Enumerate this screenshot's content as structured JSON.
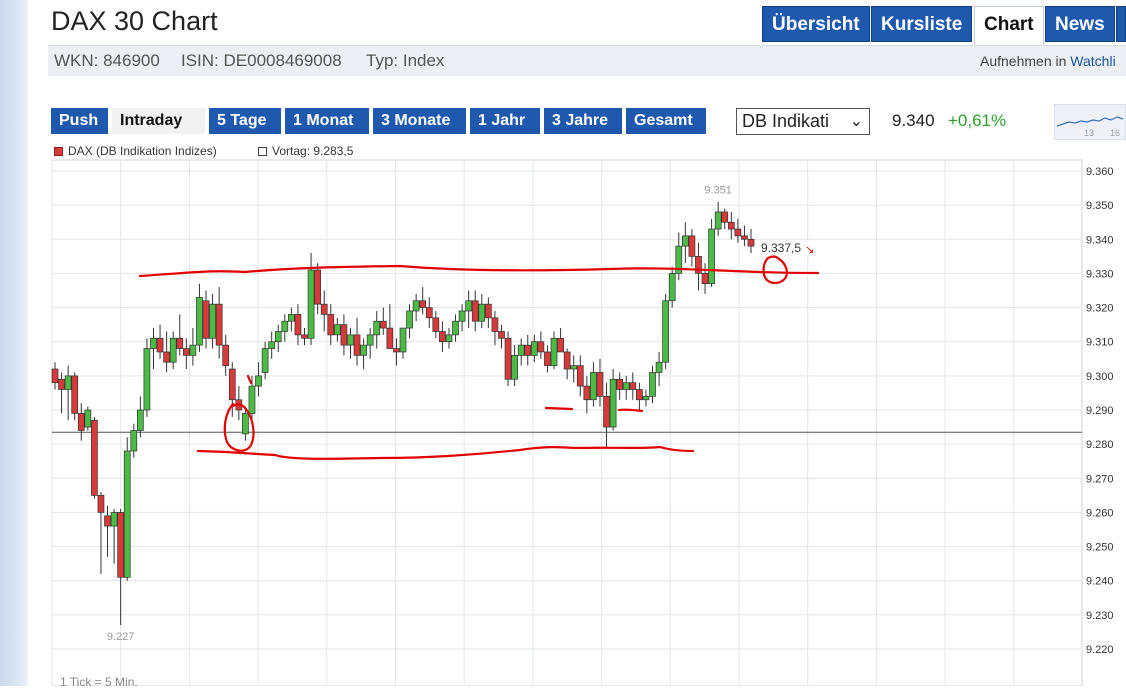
{
  "header": {
    "title": "DAX 30 Chart",
    "wkn": "WKN: 846900",
    "isin": "ISIN: DE0008469008",
    "typ": "Typ: Index",
    "watch_prefix": "Aufnehmen in",
    "watch_link": "Watchli",
    "tabs": [
      "Übersicht",
      "Kursliste",
      "Chart",
      "News"
    ],
    "active_tab": "Chart"
  },
  "toolbar": {
    "ranges": [
      "Push",
      "Intraday",
      "5 Tage",
      "1 Monat",
      "3 Monate",
      "1 Jahr",
      "3 Jahre",
      "Gesamt"
    ],
    "active_range": "Intraday",
    "source_select": "DB Indikati",
    "price": "9.340",
    "change": "+0,61%"
  },
  "mini_chart": {
    "labels": [
      "13",
      "16"
    ]
  },
  "legend": {
    "series_label": "DAX (DB Indikation Indizes)",
    "prev_close_label": "Vortag: 9.283,5"
  },
  "footer": {
    "tick_note": "1 Tick = 5 Min."
  },
  "colors": {
    "up": "#4cbb46",
    "down": "#d63a3a",
    "annotation": "#e00000",
    "tab_blue": "#1f59ad"
  },
  "chart_data": {
    "type": "candlestick",
    "y_ticks": [
      "9.360",
      "9.350",
      "9.340",
      "9.330",
      "9.320",
      "9.310",
      "9.300",
      "9.290",
      "9.280",
      "9.270",
      "9.260",
      "9.250",
      "9.240",
      "9.230",
      "9.220"
    ],
    "ylim": [
      9218,
      9362
    ],
    "reference_line": 9283.5,
    "high_label": "9.351",
    "high_value": 9351,
    "low_label": "9.227",
    "low_value": 9227,
    "last_label": "9.337,5",
    "last_value": 9337.5,
    "candles": [
      [
        9302,
        9304,
        9296,
        9298
      ],
      [
        9299,
        9301,
        9289,
        9296
      ],
      [
        9296,
        9303,
        9287,
        9300
      ],
      [
        9300,
        9301,
        9287,
        9289
      ],
      [
        9289,
        9292,
        9281,
        9284
      ],
      [
        9285,
        9291,
        9284,
        9290
      ],
      [
        9287,
        9288,
        9264,
        9265
      ],
      [
        9265,
        9266,
        9242,
        9260
      ],
      [
        9259,
        9262,
        9247,
        9256
      ],
      [
        9256,
        9261,
        9245,
        9260
      ],
      [
        9260,
        9261,
        9227,
        9241
      ],
      [
        9241,
        9282,
        9240,
        9278
      ],
      [
        9278,
        9286,
        9276,
        9284
      ],
      [
        9284,
        9294,
        9282,
        9290
      ],
      [
        9290,
        9311,
        9288,
        9308
      ],
      [
        9308,
        9314,
        9302,
        9311
      ],
      [
        9311,
        9315,
        9305,
        9307
      ],
      [
        9307,
        9313,
        9301,
        9304
      ],
      [
        9304,
        9313,
        9302,
        9311
      ],
      [
        9311,
        9318,
        9306,
        9308
      ],
      [
        9308,
        9311,
        9302,
        9306
      ],
      [
        9306,
        9314,
        9303,
        9309
      ],
      [
        9309,
        9327,
        9307,
        9323
      ],
      [
        9322,
        9325,
        9308,
        9311
      ],
      [
        9311,
        9324,
        9308,
        9321
      ],
      [
        9321,
        9326,
        9305,
        9309
      ],
      [
        9309,
        9312,
        9300,
        9303
      ],
      [
        9302,
        9304,
        9288,
        9293
      ],
      [
        9293,
        9297,
        9287,
        9290
      ],
      [
        9283,
        9291,
        9281,
        9289
      ],
      [
        9289,
        9300,
        9287,
        9297
      ],
      [
        9297,
        9304,
        9294,
        9300
      ],
      [
        9301,
        9310,
        9299,
        9308
      ],
      [
        9308,
        9313,
        9305,
        9310
      ],
      [
        9310,
        9315,
        9307,
        9313
      ],
      [
        9313,
        9318,
        9310,
        9316
      ],
      [
        9316,
        9320,
        9313,
        9318
      ],
      [
        9318,
        9321,
        9309,
        9312
      ],
      [
        9312,
        9314,
        9309,
        9311
      ],
      [
        9311,
        9336,
        9309,
        9331
      ],
      [
        9331,
        9333,
        9318,
        9321
      ],
      [
        9321,
        9325,
        9313,
        9318
      ],
      [
        9318,
        9321,
        9309,
        9312
      ],
      [
        9312,
        9317,
        9310,
        9315
      ],
      [
        9315,
        9318,
        9306,
        9309
      ],
      [
        9309,
        9314,
        9305,
        9312
      ],
      [
        9312,
        9317,
        9303,
        9306
      ],
      [
        9306,
        9311,
        9302,
        9309
      ],
      [
        9309,
        9314,
        9305,
        9312
      ],
      [
        9312,
        9319,
        9308,
        9316
      ],
      [
        9316,
        9320,
        9312,
        9314
      ],
      [
        9314,
        9321,
        9310,
        9308
      ],
      [
        9308,
        9311,
        9303,
        9307
      ],
      [
        9307,
        9310,
        9305,
        9314
      ],
      [
        9314,
        9321,
        9311,
        9319
      ],
      [
        9319,
        9324,
        9316,
        9322
      ],
      [
        9322,
        9326,
        9318,
        9320
      ],
      [
        9320,
        9323,
        9314,
        9317
      ],
      [
        9317,
        9319,
        9311,
        9313
      ],
      [
        9313,
        9316,
        9307,
        9310
      ],
      [
        9310,
        9314,
        9308,
        9312
      ],
      [
        9312,
        9318,
        9310,
        9316
      ],
      [
        9316,
        9321,
        9313,
        9319
      ],
      [
        9319,
        9325,
        9314,
        9322
      ],
      [
        9322,
        9325,
        9313,
        9316
      ],
      [
        9316,
        9324,
        9314,
        9321
      ],
      [
        9321,
        9323,
        9314,
        9317
      ],
      [
        9317,
        9319,
        9309,
        9313
      ],
      [
        9313,
        9315,
        9308,
        9311
      ],
      [
        9311,
        9313,
        9297,
        9299
      ],
      [
        9299,
        9309,
        9297,
        9306
      ],
      [
        9306,
        9311,
        9303,
        9309
      ],
      [
        9309,
        9312,
        9303,
        9306
      ],
      [
        9306,
        9312,
        9304,
        9310
      ],
      [
        9310,
        9313,
        9305,
        9307
      ],
      [
        9307,
        9309,
        9301,
        9303
      ],
      [
        9303,
        9313,
        9302,
        9311
      ],
      [
        9311,
        9314,
        9307,
        9307
      ],
      [
        9307,
        9308,
        9299,
        9302
      ],
      [
        9302,
        9306,
        9298,
        9303
      ],
      [
        9303,
        9306,
        9294,
        9297
      ],
      [
        9297,
        9300,
        9289,
        9293
      ],
      [
        9293,
        9304,
        9291,
        9301
      ],
      [
        9301,
        9305,
        9291,
        9294
      ],
      [
        9294,
        9298,
        9279,
        9285
      ],
      [
        9285,
        9302,
        9284,
        9299
      ],
      [
        9299,
        9301,
        9293,
        9296
      ],
      [
        9296,
        9300,
        9293,
        9298
      ],
      [
        9298,
        9301,
        9293,
        9296
      ],
      [
        9296,
        9298,
        9290,
        9293
      ],
      [
        9293,
        9296,
        9291,
        9294
      ],
      [
        9294,
        9303,
        9292,
        9301
      ],
      [
        9301,
        9307,
        9297,
        9304
      ],
      [
        9304,
        9324,
        9302,
        9322
      ],
      [
        9322,
        9332,
        9320,
        9330
      ],
      [
        9330,
        9342,
        9328,
        9338
      ],
      [
        9338,
        9345,
        9333,
        9341
      ],
      [
        9341,
        9343,
        9332,
        9335
      ],
      [
        9335,
        9339,
        9325,
        9330
      ],
      [
        9330,
        9333,
        9324,
        9327
      ],
      [
        9327,
        9346,
        9326,
        9343
      ],
      [
        9343,
        9351,
        9341,
        9348
      ],
      [
        9348,
        9349,
        9343,
        9345
      ],
      [
        9345,
        9348,
        9340,
        9343
      ],
      [
        9343,
        9346,
        9339,
        9341
      ],
      [
        9341,
        9344,
        9338,
        9340
      ],
      [
        9340,
        9343,
        9336,
        9338
      ]
    ]
  }
}
